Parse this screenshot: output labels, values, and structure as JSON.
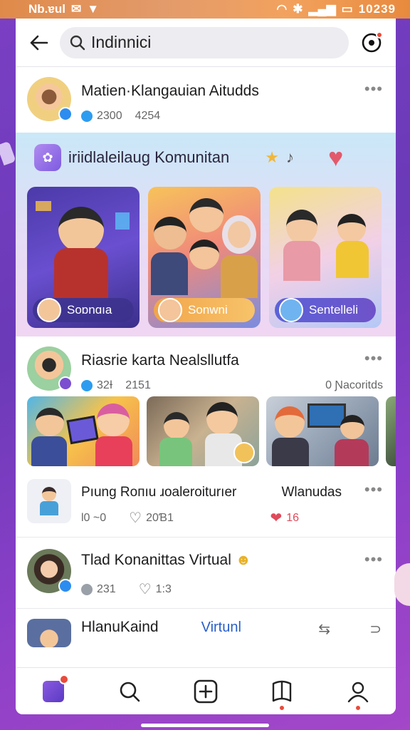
{
  "status": {
    "left": "Nb.ɐul",
    "time": "10239"
  },
  "search": {
    "query": "Indinnici"
  },
  "posts": [
    {
      "title": "Matien·Klangauian Aitudds",
      "stat1": "2300",
      "stat2": "4254"
    },
    {
      "title": "Riasrie karta Nealsllutfa",
      "stat1": "32Ɨ",
      "stat2": "2151",
      "extra": "0 Ɲacoritds"
    },
    {
      "title": "Pıung Roпıu ɹoaleroiturıer",
      "stat1": "Ɩ0 ~0",
      "stat2": "20Ɓ1",
      "tag": "Wlanudas",
      "likes": "16"
    },
    {
      "title": "Tlad Konanittas Virtual",
      "stat1": "231",
      "stat2": "1:3"
    },
    {
      "title": "HlanuKaind",
      "tag": "Virtunl"
    }
  ],
  "banner": {
    "title": "iriidlaleilaug Komunitan",
    "cards": [
      {
        "label": "Soɒnɑıa"
      },
      {
        "label": "Sonwni"
      },
      {
        "label": "Sentelleli"
      }
    ]
  },
  "colors": {
    "accent": "#7d5be0",
    "badge": "#2d8cf0",
    "alert": "#e94b3c"
  }
}
